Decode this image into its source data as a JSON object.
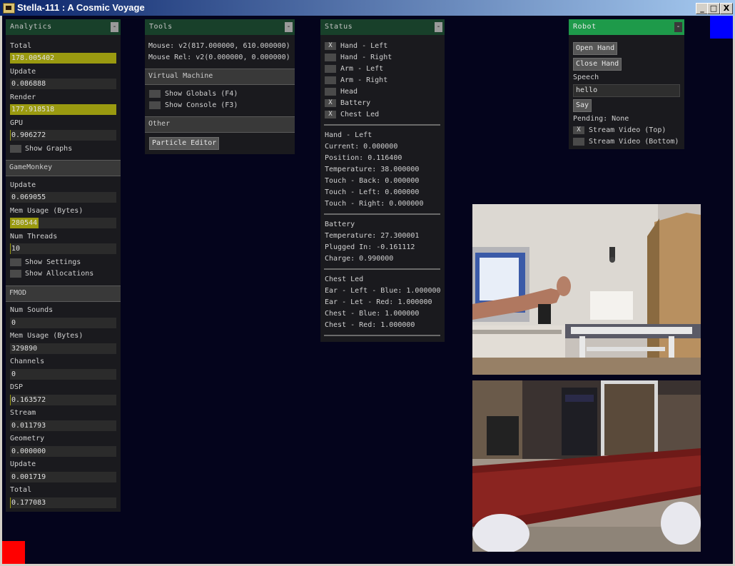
{
  "window": {
    "title": "Stella-111 : A Cosmic Voyage",
    "minimize": "_",
    "maximize": "□",
    "close": "X"
  },
  "analytics": {
    "title": "Analytics",
    "collapse": "-",
    "total_label": "Total",
    "total_value": "178.005402",
    "total_fill": 1.0,
    "update_label": "Update",
    "update_value": "0.086888",
    "update_fill": 0.0,
    "render_label": "Render",
    "render_value": "177.918518",
    "render_fill": 1.0,
    "gpu_label": "GPU",
    "gpu_value": "0.906272",
    "gpu_fill": 0.01,
    "show_graphs": "Show Graphs"
  },
  "gamemonkey": {
    "title": "GameMonkey",
    "update_label": "Update",
    "update_value": "0.069055",
    "update_fill": 0.0,
    "mem_label": "Mem Usage (Bytes)",
    "mem_value": "280544",
    "mem_fill": 0.27,
    "threads_label": "Num Threads",
    "threads_value": "10",
    "threads_fill": 0.01,
    "show_settings": "Show Settings",
    "show_allocations": "Show Allocations"
  },
  "fmod": {
    "title": "FMOD",
    "num_sounds_label": "Num Sounds",
    "num_sounds_value": "0",
    "num_sounds_fill": 0.0,
    "mem_label": "Mem Usage (Bytes)",
    "mem_value": "329890",
    "mem_fill": 0.0,
    "channels_label": "Channels",
    "channels_value": "0",
    "channels_fill": 0.0,
    "dsp_label": "DSP",
    "dsp_value": "0.163572",
    "dsp_fill": 0.01,
    "stream_label": "Stream",
    "stream_value": "0.011793",
    "stream_fill": 0.0,
    "geometry_label": "Geometry",
    "geometry_value": "0.000000",
    "geometry_fill": 0.0,
    "update_label": "Update",
    "update_value": "0.001719",
    "update_fill": 0.0,
    "total_label": "Total",
    "total_value": "0.177083",
    "total_fill": 0.01
  },
  "tools": {
    "title": "Tools",
    "collapse": "-",
    "mouse": "Mouse: v2(817.000000, 610.000000)",
    "mouse_rel": "Mouse Rel: v2(0.000000, 0.000000)",
    "vm_title": "Virtual Machine",
    "show_globals": "Show Globals (F4)",
    "show_console": "Show Console (F3)",
    "other_title": "Other",
    "particle_editor": "Particle Editor"
  },
  "status": {
    "title": "Status",
    "collapse": "-",
    "checks": [
      {
        "label": "Hand - Left",
        "mark": "X"
      },
      {
        "label": "Hand - Right",
        "mark": ""
      },
      {
        "label": "Arm - Left",
        "mark": ""
      },
      {
        "label": "Arm - Right",
        "mark": ""
      },
      {
        "label": "Head",
        "mark": ""
      },
      {
        "label": "Battery",
        "mark": "X"
      },
      {
        "label": "Chest Led",
        "mark": "X"
      }
    ],
    "hand_left_lines": [
      "Hand - Left",
      "Current: 0.000000",
      "Position: 0.116400",
      "Temperature: 38.000000",
      "Touch - Back: 0.000000",
      "Touch - Left: 0.000000",
      "Touch - Right: 0.000000"
    ],
    "battery_lines": [
      "Battery",
      "Temperature: 27.300001",
      "Plugged In: -0.161112",
      "Charge: 0.990000"
    ],
    "chest_led_lines": [
      "Chest Led",
      "Ear - Left - Blue: 1.000000",
      "Ear - Let - Red: 1.000000",
      "Chest - Blue: 1.000000",
      "Chest - Red: 1.000000"
    ]
  },
  "robot": {
    "title": "Robot",
    "collapse": "-",
    "open_hand": "Open Hand",
    "close_hand": "Close Hand",
    "speech_label": "Speech",
    "speech_value": "hello",
    "say": "Say",
    "pending": "Pending: None",
    "stream_top": "Stream Video (Top)",
    "stream_top_mark": "X",
    "stream_bottom": "Stream Video (Bottom)",
    "stream_bottom_mark": ""
  },
  "colors": {
    "background": "#04041c",
    "panel": "#1a1a1e",
    "header_green": "#18402a",
    "robot_green": "#1e9a4a",
    "fill_yellow": "#9a9a10"
  }
}
